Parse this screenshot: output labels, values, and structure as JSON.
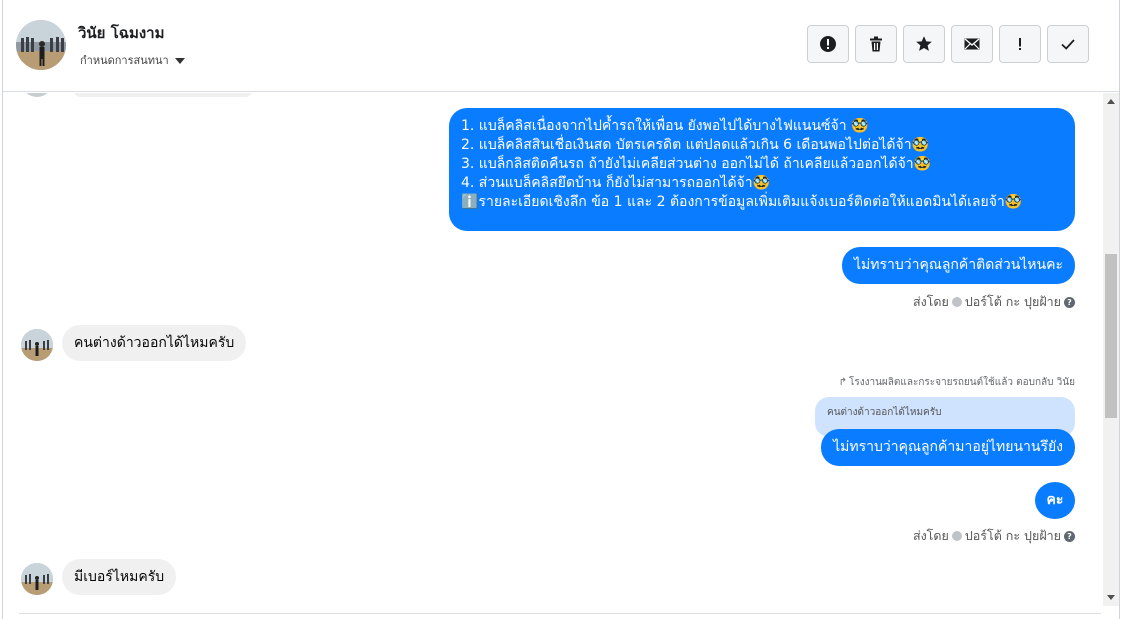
{
  "header": {
    "contact_name": "วินัย โฉมงาม",
    "assign_label": "กำหนดการสนทนา",
    "avatar_icon": "user-photo-avatar",
    "actions": [
      {
        "name": "report-button",
        "icon": "alert-circle-icon"
      },
      {
        "name": "delete-button",
        "icon": "trash-icon"
      },
      {
        "name": "star-button",
        "icon": "star-icon"
      },
      {
        "name": "mark-unread-button",
        "icon": "envelope-icon"
      },
      {
        "name": "follow-up-button",
        "icon": "exclamation-icon"
      },
      {
        "name": "mark-done-button",
        "icon": "check-icon"
      }
    ]
  },
  "messages": {
    "m1_lines": [
      "1. แบล็คลิสเนื่องจากไปค้ำรถให้เพื่อน ยังพอไปได้บางไฟแนนซ์จ้า 🥸",
      "2. แบล็คลิสสินเชื่อเงินสด บัตรเครดิต แต่ปลดแล้วเกิน 6 เดือนพอไปต่อได้จ้า🥸",
      "3. แบล็กลิสติดคืนรถ ถ้ายังไม่เคลียส่วนต่าง ออกไม่ได้ ถ้าเคลียแล้วออกได้จ้า🥸",
      "4. ส่วนแบล็คลิสยึดบ้าน ก็ยังไม่สามารถออกได้จ้า🥸",
      "ℹ️รายละเอียดเชิงลึก ข้อ 1 และ 2 ต้องการข้อมูลเพิ่มเติมแจ้งเบอร์ติดต่อให้แอดมินได้เลยจ้า🥸"
    ],
    "m2": "ไม่ทราบว่าคุณลูกค้าติดส่วนไหนคะ",
    "sent_by_1": "ส่งโดย",
    "sender_1": "ปอร์โต้ กะ ปุยฝ้าย",
    "m3": "คนต่างด้าวออกได้ไหมครับ",
    "reply_note": "โรงงานผลิตและกระจายรถยนต์ใช้แล้ว ตอบกลับ วินัย",
    "reply_quote": "คนต่างด้าวออกได้ไหมครับ",
    "m4": "ไม่ทราบว่าคุณลูกค้ามาอยู่ไทยนานรึยัง",
    "m5": "คะ",
    "sent_by_2": "ส่งโดย",
    "sender_2": "ปอร์โต้ กะ ปุยฝ้าย",
    "m6": "มีเบอร์ไหมครับ"
  },
  "colors": {
    "outgoing_bubble": "#0a7cff",
    "incoming_bubble": "#f0f0f0",
    "reply_quote_bg": "#cfe3ff"
  }
}
